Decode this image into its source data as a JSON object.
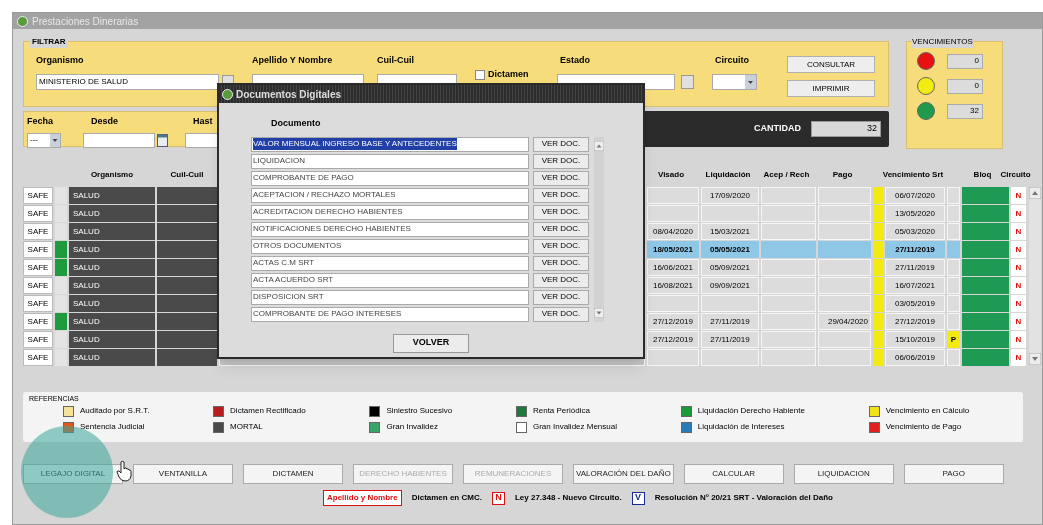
{
  "window": {
    "title": "Prestaciones Dinerarias"
  },
  "filter": {
    "legend": "FILTRAR",
    "organismo_label": "Organismo",
    "organismo_value": "MINISTERIO DE SALUD",
    "apellido_label": "Apellido Y Nombre",
    "cuil_label": "Cuil-Cuil",
    "dictamen_label": "Dictamen",
    "dictamen_checked": false,
    "estado_label": "Estado",
    "circuito_label": "Circuito",
    "fecha_label": "Fecha",
    "fecha_value": "---",
    "desde_label": "Desde",
    "hasta_label": "Hast",
    "buttons": [
      "CONSULTAR",
      "IMPRIMIR"
    ]
  },
  "cantidad": {
    "label": "CANTIDAD",
    "value": "32"
  },
  "vencimientos": {
    "legend": "VENCIMIENTOS",
    "items": [
      {
        "color": "#e81010",
        "value": "0"
      },
      {
        "color": "#f2ec10",
        "value": "0"
      },
      {
        "color": "#1f9a4c",
        "value": "32"
      }
    ]
  },
  "table": {
    "columns": [
      "Organismo",
      "Cuil-Cuil",
      "Visado",
      "Liquidación",
      "Acep / Rech",
      "Pago",
      "Vencimiento Srt",
      "Bloq",
      "Circuito"
    ],
    "rows": [
      {
        "origin": "SAFE",
        "marked": false,
        "selected": false,
        "organismo": "SALUD",
        "liquidacion": "17/09/2020",
        "vencimiento": "06/07/2020",
        "circuito": "N"
      },
      {
        "origin": "SAFE",
        "marked": false,
        "selected": false,
        "organismo": "SALUD",
        "vencimiento": "13/05/2020",
        "circuito": "N"
      },
      {
        "origin": "SAFE",
        "marked": false,
        "selected": false,
        "organismo": "SALUD",
        "visado": "08/04/2020",
        "liquidacion": "15/03/2021",
        "vencimiento": "05/03/2020",
        "circuito": "N"
      },
      {
        "origin": "SAFE",
        "marked": true,
        "selected": true,
        "organismo": "SALUD",
        "visado": "18/05/2021",
        "liquidacion": "05/05/2021",
        "vencimiento": "27/11/2019",
        "circuito": "N"
      },
      {
        "origin": "SAFE",
        "marked": true,
        "selected": false,
        "organismo": "SALUD",
        "visado": "16/06/2021",
        "liquidacion": "05/09/2021",
        "vencimiento": "27/11/2019",
        "circuito": "N"
      },
      {
        "origin": "SAFE",
        "marked": false,
        "selected": false,
        "organismo": "SALUD",
        "visado": "16/08/2021",
        "liquidacion": "09/09/2021",
        "vencimiento": "16/07/2021",
        "circuito": "N"
      },
      {
        "origin": "SAFE",
        "marked": false,
        "selected": false,
        "organismo": "SALUD",
        "vencimiento": "03/05/2019",
        "circuito": "N"
      },
      {
        "origin": "SAFE",
        "marked": true,
        "selected": false,
        "organismo": "SALUD",
        "visado": "27/12/2019",
        "liquidacion": "27/11/2019",
        "pago": "29/04/2020",
        "vencimiento": "27/12/2019",
        "circuito": "N"
      },
      {
        "origin": "SAFE",
        "marked": false,
        "selected": false,
        "organismo": "SALUD",
        "visado": "27/12/2019",
        "liquidacion": "27/11/2019",
        "vencimiento": "15/10/2019",
        "srt": "P",
        "circuito": "N"
      },
      {
        "origin": "SAFE",
        "marked": false,
        "selected": false,
        "organismo": "SALUD",
        "vencimiento": "06/06/2019",
        "circuito": "N"
      }
    ]
  },
  "dialog": {
    "title": "Documentos Digitales",
    "column": "Documento",
    "back_button": "VOLVER",
    "items": [
      {
        "label": "VALOR MENSUAL INGRESO BASE Y ANTECEDENTES",
        "selected": true,
        "button": "VER DOC."
      },
      {
        "label": "LIQUIDACION",
        "selected": false,
        "button": "VER DOC."
      },
      {
        "label": "COMPROBANTE DE PAGO",
        "selected": false,
        "button": "VER DOC."
      },
      {
        "label": "ACEPTACION / RECHAZO MORTALES",
        "selected": false,
        "button": "VER DOC."
      },
      {
        "label": "ACREDITACION DERECHO HABIENTES",
        "selected": false,
        "button": "VER DOC."
      },
      {
        "label": "NOTIFICACIONES DERECHO HABIENTES",
        "selected": false,
        "button": "VER DOC."
      },
      {
        "label": "OTROS DOCUMENTOS",
        "selected": false,
        "button": "VER DOC."
      },
      {
        "label": "ACTAS C.M SRT",
        "selected": false,
        "button": "VER DOC."
      },
      {
        "label": "ACTA ACUERDO SRT",
        "selected": false,
        "button": "VER DOC."
      },
      {
        "label": "DISPOSICION SRT",
        "selected": false,
        "button": "VER DOC."
      },
      {
        "label": "COMPROBANTE DE PAGO INTERESES",
        "selected": false,
        "button": "VER DOC."
      }
    ]
  },
  "references": {
    "title": "REFERENCIAS",
    "items": [
      {
        "label": "Auditado por S.R.T.",
        "color": "#f6e39a"
      },
      {
        "label": "Sentencia Judicial",
        "color": "#e0561c"
      },
      {
        "label": "Dictamen Rectificado",
        "color": "#b81c1c"
      },
      {
        "label": "MORTAL",
        "color": "#4a4a4a"
      },
      {
        "label": "Siniestro Sucesivo",
        "color": "#000000"
      },
      {
        "label": "Gran Invalidez",
        "color": "#3aa368"
      },
      {
        "label": "Renta Periódica",
        "color": "#1e7a3c"
      },
      {
        "label": "Gran Invalidez Mensual",
        "color": "#ffffff"
      },
      {
        "label": "Liquidación Derecho Habiente",
        "color": "#1a9a3a"
      },
      {
        "label": "Liquidación de Intereses",
        "color": "#2a7ab8"
      },
      {
        "label": "Vencimiento en Cálculo",
        "color": "#f2e21a"
      },
      {
        "label": "Vencimiento de Pago",
        "color": "#e02020"
      }
    ]
  },
  "actions": [
    {
      "label": "LEGAJO DIGITAL",
      "disabled": false
    },
    {
      "label": "VENTANILLA",
      "disabled": false
    },
    {
      "label": "DICTAMEN",
      "disabled": false
    },
    {
      "label": "DERECHO HABIENTES",
      "disabled": true
    },
    {
      "label": "REMUNERACIONES",
      "disabled": true
    },
    {
      "label": "VALORACIÓN DEL DAÑO",
      "disabled": false
    },
    {
      "label": "CALCULAR",
      "disabled": false
    },
    {
      "label": "LIQUIDACION",
      "disabled": false
    },
    {
      "label": "PAGO",
      "disabled": false
    }
  ],
  "legend": [
    {
      "kind": "boxed",
      "text": "Apellido y Nombre",
      "color": "#e01010"
    },
    {
      "kind": "text",
      "text": "Dictamen en CMC."
    },
    {
      "kind": "letter",
      "text": "N",
      "color": "#e01010"
    },
    {
      "kind": "text",
      "text": "Ley 27.348 - Nuevo Circuito."
    },
    {
      "kind": "letter",
      "text": "V",
      "color": "#1a2a9a"
    },
    {
      "kind": "text",
      "text": "Resolución N° 20/21 SRT - Valoración del Daño"
    }
  ]
}
